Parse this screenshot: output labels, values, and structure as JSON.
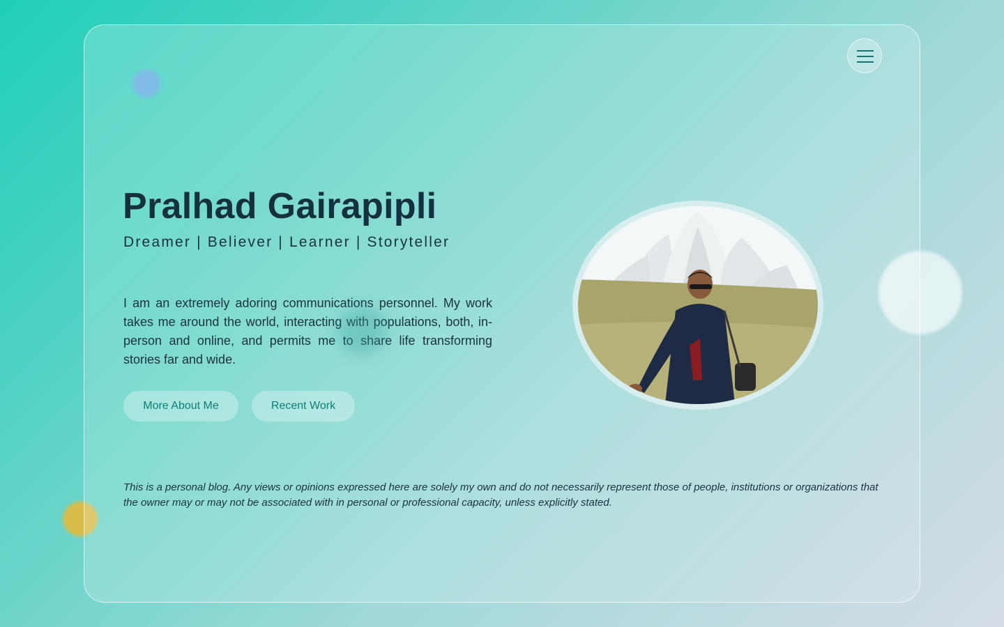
{
  "header": {
    "menu_icon": "hamburger-menu-icon"
  },
  "hero": {
    "name": "Pralhad Gairapipli",
    "tagline": "Dreamer | Believer | Learner | Storyteller",
    "bio": "I am an extremely adoring communications personnel. My work takes me around the world, interacting with populations, both, in-person and online, and permits me to share life transforming stories far and wide.",
    "buttons": {
      "more_about": "More About Me",
      "recent_work": "Recent Work"
    }
  },
  "footer": {
    "disclaimer": "This is a personal blog. Any views or opinions expressed here are solely my own and do not necessarily represent those of people, institutions or organizations that the owner may or may not be associated with in personal or professional capacity, unless explicitly stated."
  },
  "colors": {
    "accent": "#0e7d78",
    "heading": "#15303f",
    "body_text": "#1a3240"
  }
}
